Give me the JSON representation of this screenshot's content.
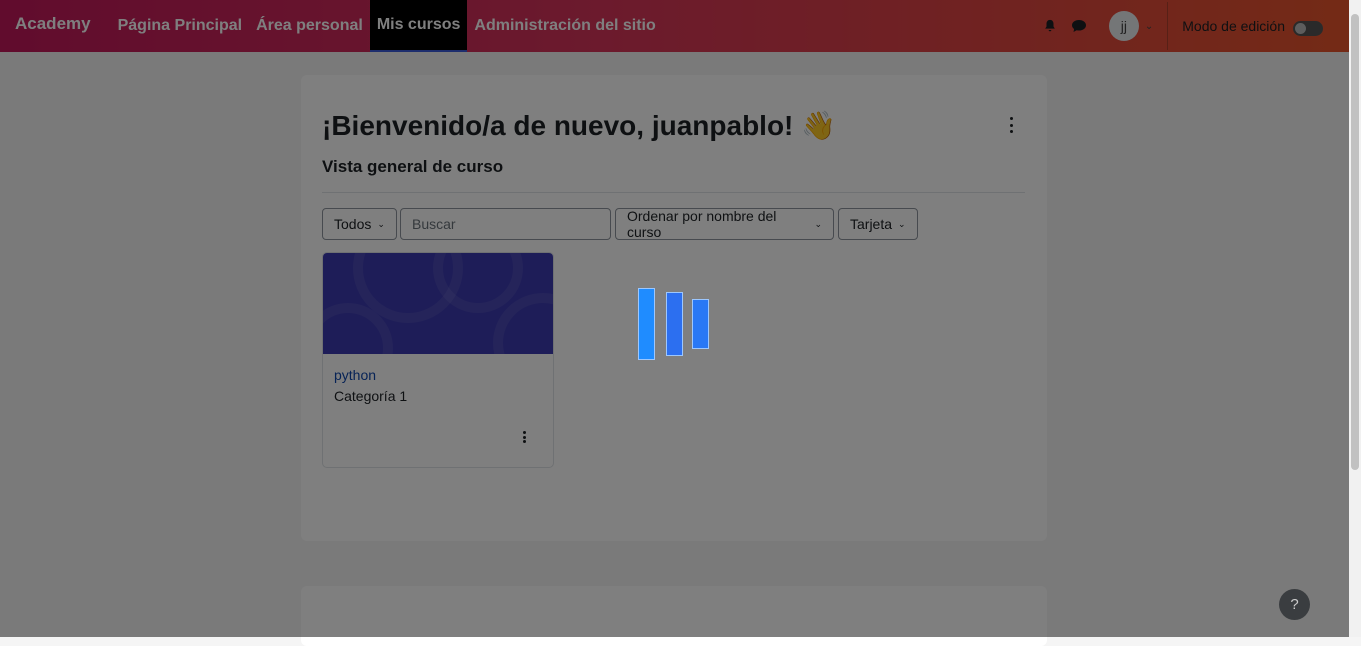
{
  "navbar": {
    "brand": "Academy",
    "items": [
      {
        "label": "Página Principal"
      },
      {
        "label": "Área personal"
      },
      {
        "label": "Mis cursos"
      },
      {
        "label": "Administración del sitio"
      }
    ],
    "active_item": "Mis cursos",
    "icons": [
      "bell-icon",
      "chat-icon"
    ],
    "avatar_initials": "jj",
    "edit_mode_label": "Modo de edición",
    "edit_mode_on": false
  },
  "main": {
    "welcome": "¡Bienvenido/a de nuevo, juanpablo!",
    "wave_emoji": "👋",
    "section_title": "Vista general de curso",
    "filters": {
      "grouping": "Todos",
      "search_placeholder": "Buscar",
      "sort": "Ordenar por nombre del curso",
      "view": "Tarjeta"
    },
    "courses": [
      {
        "name": "python",
        "category": "Categoría 1"
      }
    ]
  },
  "loading": {
    "visible": true
  },
  "help_label": "?",
  "colors": {
    "navbar_start": "#c2185b",
    "navbar_end": "#e8552c",
    "active_nav": "#000000",
    "course_image": "#3d3bb0",
    "loader": "#1f8cff",
    "link": "#0f47ad"
  }
}
